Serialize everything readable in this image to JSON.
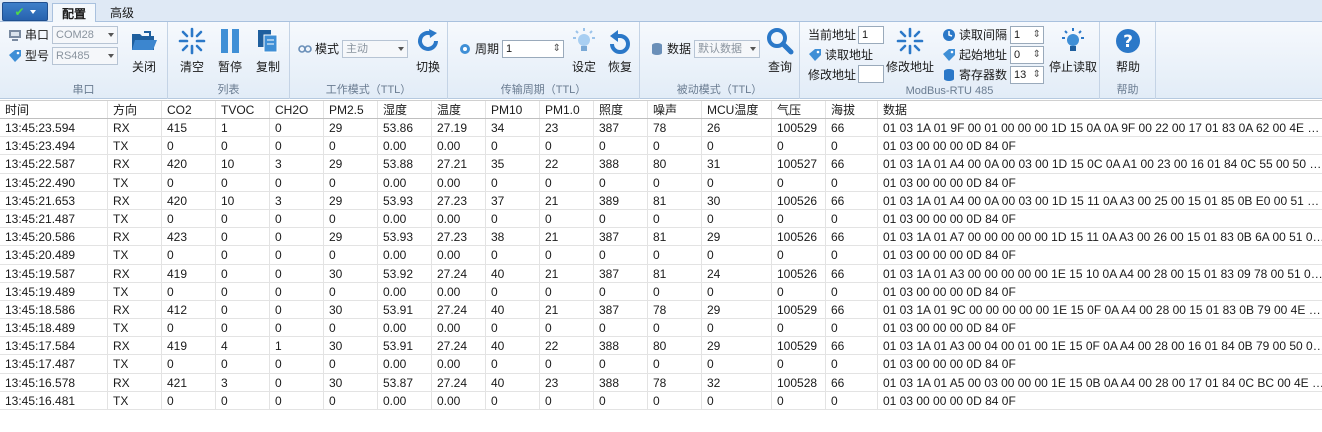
{
  "tabs": {
    "config": "配置",
    "advanced": "高级"
  },
  "ribbon": {
    "serial": {
      "port_label": "串口",
      "port_value": "COM28",
      "model_label": "型号",
      "model_value": "RS485",
      "close_label": "关闭",
      "group_label": "串口"
    },
    "list": {
      "clear_label": "清空",
      "pause_label": "暂停",
      "copy_label": "复制",
      "group_label": "列表"
    },
    "work_mode": {
      "mode_label": "模式",
      "mode_value": "主动",
      "switch_label": "切换",
      "group_label": "工作模式（TTL）"
    },
    "period": {
      "period_label": "周期",
      "period_value": "1",
      "set_label": "设定",
      "restore_label": "恢复",
      "group_label": "传输周期（TTL）"
    },
    "passive": {
      "data_label": "数据",
      "data_value": "默认数据",
      "query_label": "查询",
      "group_label": "被动模式（TTL）"
    },
    "modbus": {
      "current_addr_label": "当前地址",
      "current_addr_value": "1",
      "read_addr_label": "读取地址",
      "modify_addr_label": "修改地址",
      "modify_addr_value": "",
      "modify_addr_btn": "修改地址",
      "read_interval_label": "读取间隔",
      "read_interval_value": "1",
      "start_addr_label": "起始地址",
      "start_addr_value": "0",
      "reg_count_label": "寄存器数",
      "reg_count_value": "13",
      "stop_read_label": "停止读取",
      "group_label": "ModBus-RTU 485"
    },
    "help": {
      "help_label": "帮助",
      "group_label": "帮助"
    }
  },
  "table": {
    "columns": [
      "时间",
      "方向",
      "CO2",
      "TVOC",
      "CH2O",
      "PM2.5",
      "湿度",
      "温度",
      "PM10",
      "PM1.0",
      "照度",
      "噪声",
      "MCU温度",
      "气压",
      "海拔",
      "数据"
    ],
    "rows": [
      [
        "13:45:23.594",
        "RX",
        "415",
        "1",
        "0",
        "29",
        "53.86",
        "27.19",
        "34",
        "23",
        "387",
        "78",
        "26",
        "100529",
        "66",
        "01 03 1A 01 9F 00 01 00 00 00 1D 15 0A 0A 9F 00 22 00 17 01 83 0A 62 00 4E 00 0..."
      ],
      [
        "13:45:23.494",
        "TX",
        "0",
        "0",
        "0",
        "0",
        "0.00",
        "0.00",
        "0",
        "0",
        "0",
        "0",
        "0",
        "0",
        "0",
        "01 03 00 00 00 0D 84 0F"
      ],
      [
        "13:45:22.587",
        "RX",
        "420",
        "10",
        "3",
        "29",
        "53.88",
        "27.21",
        "35",
        "22",
        "388",
        "80",
        "31",
        "100527",
        "66",
        "01 03 1A 01 A4 00 0A 00 03 00 1D 15 0C 0A A1 00 23 00 16 01 84 0C 55 00 50 00 ..."
      ],
      [
        "13:45:22.490",
        "TX",
        "0",
        "0",
        "0",
        "0",
        "0.00",
        "0.00",
        "0",
        "0",
        "0",
        "0",
        "0",
        "0",
        "0",
        "01 03 00 00 00 0D 84 0F"
      ],
      [
        "13:45:21.653",
        "RX",
        "420",
        "10",
        "3",
        "29",
        "53.93",
        "27.23",
        "37",
        "21",
        "389",
        "81",
        "30",
        "100526",
        "66",
        "01 03 1A 01 A4 00 0A 00 03 00 1D 15 11 0A A3 00 25 00 15 01 85 0B E0 00 51 00 ..."
      ],
      [
        "13:45:21.487",
        "TX",
        "0",
        "0",
        "0",
        "0",
        "0.00",
        "0.00",
        "0",
        "0",
        "0",
        "0",
        "0",
        "0",
        "0",
        "01 03 00 00 00 0D 84 0F"
      ],
      [
        "13:45:20.586",
        "RX",
        "423",
        "0",
        "0",
        "29",
        "53.93",
        "27.23",
        "38",
        "21",
        "387",
        "81",
        "29",
        "100526",
        "66",
        "01 03 1A 01 A7 00 00 00 00 00 1D 15 11 0A A3 00 26 00 15 01 83 0B 6A 00 51 00 ..."
      ],
      [
        "13:45:20.489",
        "TX",
        "0",
        "0",
        "0",
        "0",
        "0.00",
        "0.00",
        "0",
        "0",
        "0",
        "0",
        "0",
        "0",
        "0",
        "01 03 00 00 00 0D 84 0F"
      ],
      [
        "13:45:19.587",
        "RX",
        "419",
        "0",
        "0",
        "30",
        "53.92",
        "27.24",
        "40",
        "21",
        "387",
        "81",
        "24",
        "100526",
        "66",
        "01 03 1A 01 A3 00 00 00 00 00 1E 15 10 0A A4 00 28 00 15 01 83 09 78 00 51 00 0..."
      ],
      [
        "13:45:19.489",
        "TX",
        "0",
        "0",
        "0",
        "0",
        "0.00",
        "0.00",
        "0",
        "0",
        "0",
        "0",
        "0",
        "0",
        "0",
        "01 03 00 00 00 0D 84 0F"
      ],
      [
        "13:45:18.586",
        "RX",
        "412",
        "0",
        "0",
        "30",
        "53.91",
        "27.24",
        "40",
        "21",
        "387",
        "78",
        "29",
        "100529",
        "66",
        "01 03 1A 01 9C 00 00 00 00 00 1E 15 0F 0A A4 00 28 00 15 01 83 0B 79 00 4E 00 0..."
      ],
      [
        "13:45:18.489",
        "TX",
        "0",
        "0",
        "0",
        "0",
        "0.00",
        "0.00",
        "0",
        "0",
        "0",
        "0",
        "0",
        "0",
        "0",
        "01 03 00 00 00 0D 84 0F"
      ],
      [
        "13:45:17.584",
        "RX",
        "419",
        "4",
        "1",
        "30",
        "53.91",
        "27.24",
        "40",
        "22",
        "388",
        "80",
        "29",
        "100529",
        "66",
        "01 03 1A 01 A3 00 04 00 01 00 1E 15 0F 0A A4 00 28 00 16 01 84 0B 79 00 50 00 0..."
      ],
      [
        "13:45:17.487",
        "TX",
        "0",
        "0",
        "0",
        "0",
        "0.00",
        "0.00",
        "0",
        "0",
        "0",
        "0",
        "0",
        "0",
        "0",
        "01 03 00 00 00 0D 84 0F"
      ],
      [
        "13:45:16.578",
        "RX",
        "421",
        "3",
        "0",
        "30",
        "53.87",
        "27.24",
        "40",
        "23",
        "388",
        "78",
        "32",
        "100528",
        "66",
        "01 03 1A 01 A5 00 03 00 00 00 1E 15 0B 0A A4 00 28 00 17 01 84 0C BC 00 4E 00 ..."
      ],
      [
        "13:45:16.481",
        "TX",
        "0",
        "0",
        "0",
        "0",
        "0.00",
        "0.00",
        "0",
        "0",
        "0",
        "0",
        "0",
        "0",
        "0",
        "01 03 00 00 00 0D 84 0F"
      ]
    ]
  },
  "icons": {
    "port": "port-icon",
    "model": "tag-icon",
    "close": "folder-open-icon",
    "clear": "sparkle-icon",
    "pause": "pause-icon",
    "copy": "copy-icon",
    "mode": "link-icon",
    "switch": "refresh-icon",
    "period": "gear-icon",
    "set": "bulb-icon",
    "restore": "undo-icon",
    "data": "database-icon",
    "query": "magnifier-icon",
    "help": "help-icon"
  }
}
